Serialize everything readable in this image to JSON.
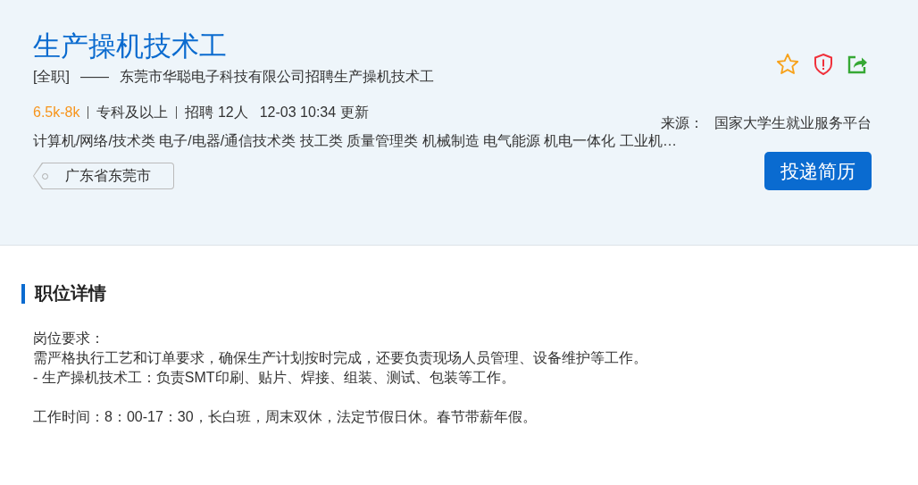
{
  "job": {
    "title": "生产操机技术工",
    "employment_type": "[全职]",
    "separator": "——",
    "company_line": "东莞市华聪电子科技有限公司招聘生产操机技术工",
    "salary": "6.5k-8k",
    "meta": [
      "专科及以上",
      "招聘 12人"
    ],
    "updated": "12-03 10:34 更新",
    "categories": "计算机/网络/技术类 电子/电器/通信技术类 技工类 质量管理类 机械制造 电气能源 机电一体化 工业机…",
    "location": "广东省东莞市",
    "source_label": "来源：",
    "source": "国家大学生就业服务平台",
    "apply_button": "投递简历"
  },
  "details": {
    "heading": "职位详情",
    "blocks": [
      [
        "岗位要求：",
        "需严格执行工艺和订单要求，确保生产计划按时完成，还要负责现场人员管理、设备维护等工作。",
        "- 生产操机技术工：负责SMT印刷、贴片、焊接、组装、测试、包装等工作。"
      ],
      [
        "工作时间：8：00-17：30，长白班，周末双休，法定节假日休。春节带薪年假。"
      ]
    ]
  }
}
